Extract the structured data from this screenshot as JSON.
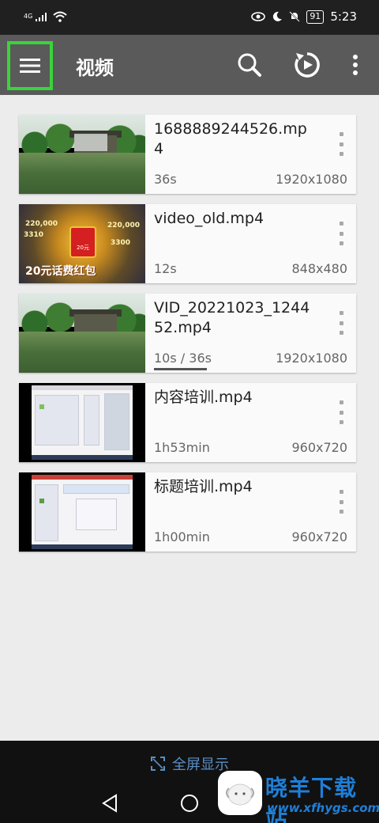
{
  "status": {
    "network": "4G",
    "battery": "91",
    "time": "5:23"
  },
  "app_bar": {
    "title": "视频"
  },
  "videos": [
    {
      "name": "1688889244526.mp4",
      "duration": "36s",
      "resolution": "1920x1080",
      "thumb": "park"
    },
    {
      "name": "video_old.mp4",
      "duration": "12s",
      "resolution": "848x480",
      "thumb": "game",
      "thumb_caption": "20元话费红包",
      "thumb_badge": "20元",
      "thumb_numbers": [
        "220,000",
        "3310",
        "220,000",
        "3300"
      ]
    },
    {
      "name": "VID_20221023_124452.mp4",
      "duration": "10s / 36s",
      "resolution": "1920x1080",
      "thumb": "park",
      "progress": 0.28
    },
    {
      "name": "内容培训.mp4",
      "duration": "1h53min",
      "resolution": "960x720",
      "thumb": "screen"
    },
    {
      "name": "标题培训.mp4",
      "duration": "1h00min",
      "resolution": "960x720",
      "thumb": "screen"
    }
  ],
  "bottom": {
    "fullscreen_label": "全屏显示"
  },
  "watermark": {
    "text": "晓羊下载站",
    "url": "www.xfhygs.com"
  },
  "colors": {
    "app_bar": "#5a5a5a",
    "highlight": "#39d43a",
    "link": "#5a8fc4",
    "watermark": "#1e7fd8"
  }
}
